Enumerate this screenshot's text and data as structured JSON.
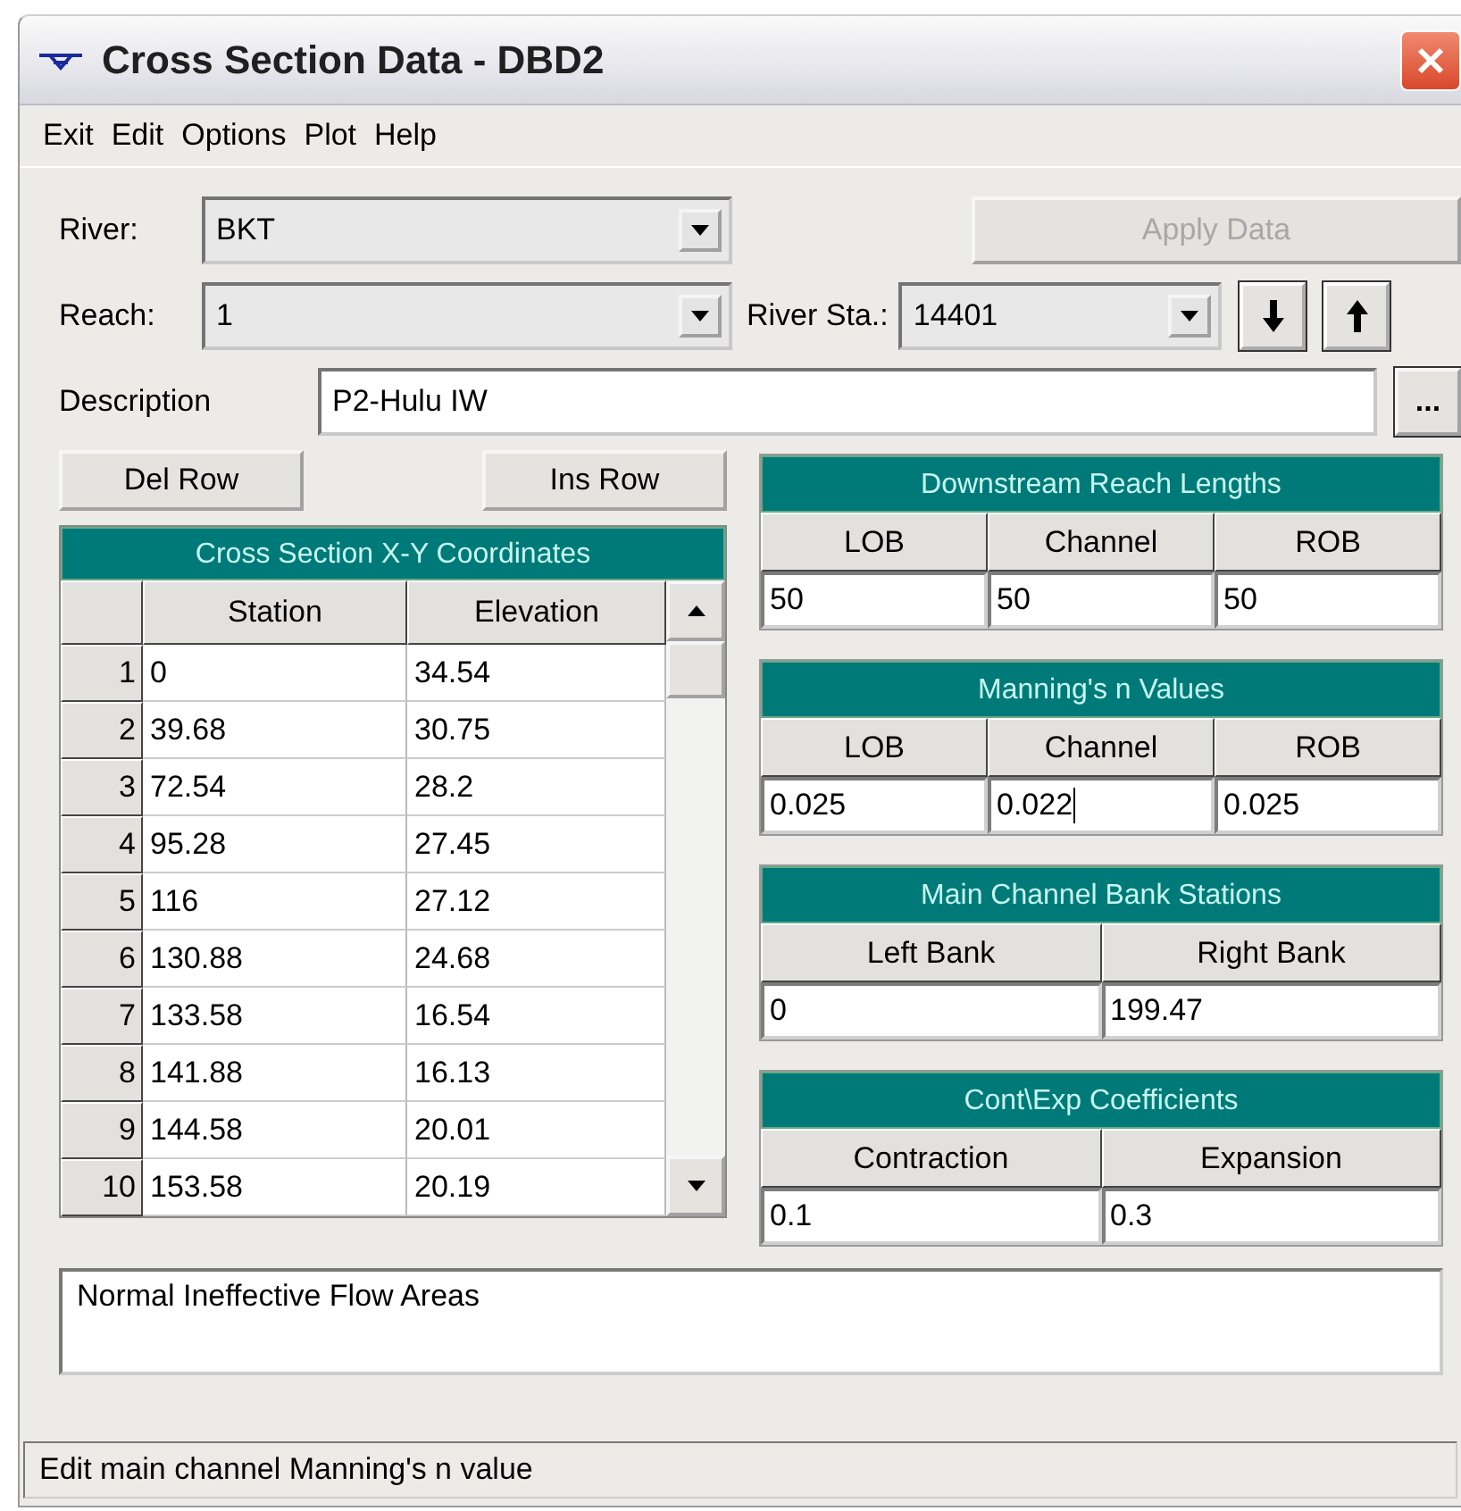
{
  "window": {
    "title": "Cross Section Data - DBD2"
  },
  "menu": [
    "Exit",
    "Edit",
    "Options",
    "Plot",
    "Help"
  ],
  "river": {
    "label": "River:",
    "value": "BKT"
  },
  "apply_button": {
    "label": "Apply Data",
    "disabled": true
  },
  "reach": {
    "label": "Reach:",
    "value": "1"
  },
  "river_station": {
    "label": "River Sta.:",
    "value": "14401"
  },
  "description": {
    "label": "Description",
    "value": "P2-Hulu IW",
    "button": "..."
  },
  "row_buttons": [
    "Del Row",
    "Ins Row"
  ],
  "xy_table": {
    "title": "Cross Section X-Y Coordinates",
    "columns": [
      "Station",
      "Elevation"
    ],
    "rows": [
      {
        "number": "1",
        "station": "0",
        "elevation": "34.54"
      },
      {
        "number": "2",
        "station": "39.68",
        "elevation": "30.75"
      },
      {
        "number": "3",
        "station": "72.54",
        "elevation": "28.2"
      },
      {
        "number": "4",
        "station": "95.28",
        "elevation": "27.45"
      },
      {
        "number": "5",
        "station": "116",
        "elevation": "27.12"
      },
      {
        "number": "6",
        "station": "130.88",
        "elevation": "24.68"
      },
      {
        "number": "7",
        "station": "133.58",
        "elevation": "16.54"
      },
      {
        "number": "8",
        "station": "141.88",
        "elevation": "16.13"
      },
      {
        "number": "9",
        "station": "144.58",
        "elevation": "20.01"
      },
      {
        "number": "10",
        "station": "153.58",
        "elevation": "20.19"
      }
    ]
  },
  "panels": [
    {
      "title": "Downstream Reach Lengths",
      "columns": [
        "LOB",
        "Channel",
        "ROB"
      ],
      "values": [
        {
          "text": "50",
          "editing": false
        },
        {
          "text": "50",
          "editing": false
        },
        {
          "text": "50",
          "editing": false
        }
      ]
    },
    {
      "title": "Manning's n Values",
      "columns": [
        "LOB",
        "Channel",
        "ROB"
      ],
      "values": [
        {
          "text": "0.025",
          "editing": false
        },
        {
          "text": "0.022",
          "editing": true
        },
        {
          "text": "0.025",
          "editing": false
        }
      ]
    },
    {
      "title": "Main Channel Bank Stations",
      "columns": [
        "Left Bank",
        "Right Bank"
      ],
      "values": [
        {
          "text": "0",
          "editing": false
        },
        {
          "text": "199.47",
          "editing": false
        }
      ]
    },
    {
      "title": "Cont\\Exp  Coefficients",
      "columns": [
        "Contraction",
        "Expansion"
      ],
      "values": [
        {
          "text": "0.1",
          "editing": false
        },
        {
          "text": "0.3",
          "editing": false
        }
      ]
    }
  ],
  "notes": "Normal Ineffective Flow Areas",
  "status_bar": "Edit main channel Manning's n value"
}
